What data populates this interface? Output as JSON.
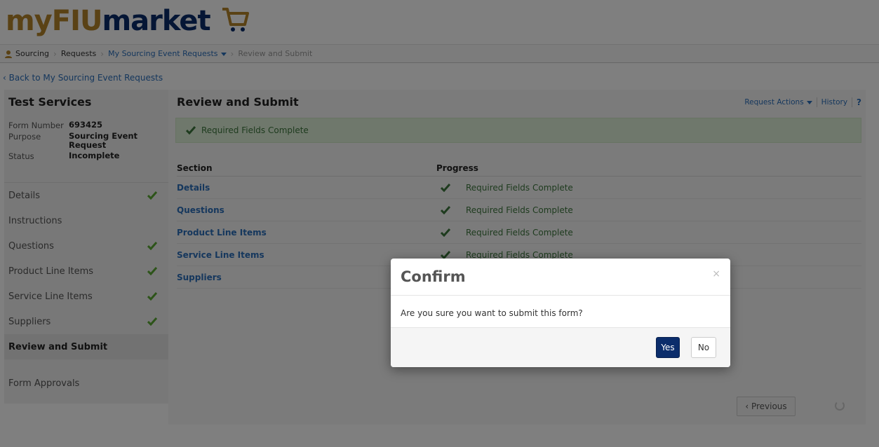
{
  "header": {
    "logo_part1": "myFIU",
    "logo_part2": "market",
    "cart_icon": "shopping-cart-icon",
    "brand_colors": {
      "gold": "#b5842a",
      "navy": "#0b2d6b"
    }
  },
  "breadcrumb": {
    "items": [
      {
        "label": "Sourcing"
      },
      {
        "label": "Requests"
      },
      {
        "label": "My Sourcing Event Requests"
      },
      {
        "label": "Review and Submit"
      }
    ]
  },
  "back_link": "‹ Back to My Sourcing Event Requests",
  "sidebar": {
    "title": "Test Services",
    "meta": [
      {
        "key": "Form Number",
        "value": "693425"
      },
      {
        "key": "Purpose",
        "value": "Sourcing Event Request"
      },
      {
        "key": "Status",
        "value": "Incomplete"
      }
    ],
    "nav": [
      {
        "label": "Details",
        "complete": true
      },
      {
        "label": "Instructions",
        "complete": false
      },
      {
        "label": "Questions",
        "complete": true
      },
      {
        "label": "Product Line Items",
        "complete": true
      },
      {
        "label": "Service Line Items",
        "complete": true
      },
      {
        "label": "Suppliers",
        "complete": true
      },
      {
        "label": "Review and Submit",
        "complete": false,
        "active": true
      }
    ],
    "approvals": "Form Approvals"
  },
  "main": {
    "title": "Review and Submit",
    "actions": {
      "request_actions": "Request Actions",
      "history": "History",
      "help": "?"
    },
    "alert": "Required Fields Complete",
    "table": {
      "headers": {
        "section": "Section",
        "progress": "Progress"
      },
      "rows": [
        {
          "section": "Details",
          "progress": "Required Fields Complete"
        },
        {
          "section": "Questions",
          "progress": "Required Fields Complete"
        },
        {
          "section": "Product Line Items",
          "progress": "Required Fields Complete"
        },
        {
          "section": "Service Line Items",
          "progress": "Required Fields Complete"
        },
        {
          "section": "Suppliers",
          "progress": ""
        }
      ]
    },
    "previous_button": "‹ Previous"
  },
  "modal": {
    "title": "Confirm",
    "close": "×",
    "body": "Are you sure you want to submit this form?",
    "yes": "Yes",
    "no": "No"
  }
}
